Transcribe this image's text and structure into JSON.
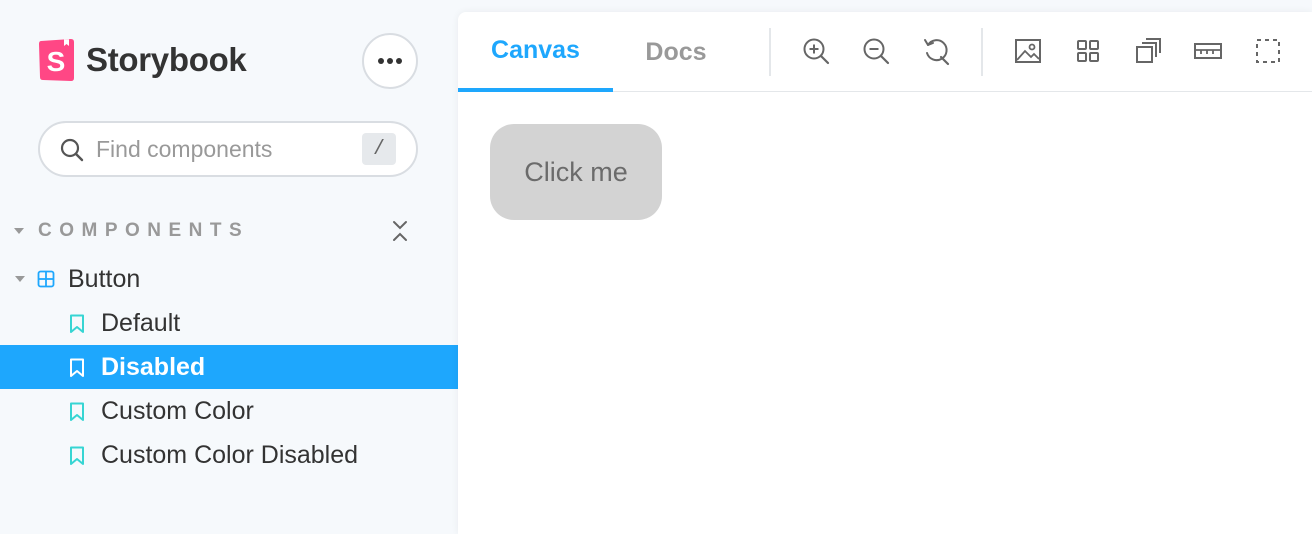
{
  "brand": {
    "name": "Storybook",
    "logo_letter": "S",
    "logo_color": "#ff4785"
  },
  "sidebar": {
    "search": {
      "placeholder": "Find components",
      "shortcut": "/"
    },
    "section": {
      "label": "COMPONENTS"
    },
    "tree": {
      "component": {
        "label": "Button"
      },
      "stories": [
        {
          "label": "Default",
          "selected": false
        },
        {
          "label": "Disabled",
          "selected": true
        },
        {
          "label": "Custom Color",
          "selected": false
        },
        {
          "label": "Custom Color Disabled",
          "selected": false
        }
      ]
    }
  },
  "toolbar": {
    "tabs": [
      {
        "label": "Canvas",
        "active": true
      },
      {
        "label": "Docs",
        "active": false
      }
    ],
    "tools": [
      "zoom-in-icon",
      "zoom-out-icon",
      "reset-zoom-icon",
      "background-image-icon",
      "grid-icon",
      "viewport-icon",
      "measure-icon",
      "outline-icon"
    ]
  },
  "canvas": {
    "button_label": "Click me"
  },
  "colors": {
    "accent": "#1ea7fd",
    "story_icon": "#37d5d3",
    "component_icon": "#1ea7fd",
    "sidebar_bg": "#f6f9fc",
    "demo_button_bg": "#d3d3d3"
  }
}
